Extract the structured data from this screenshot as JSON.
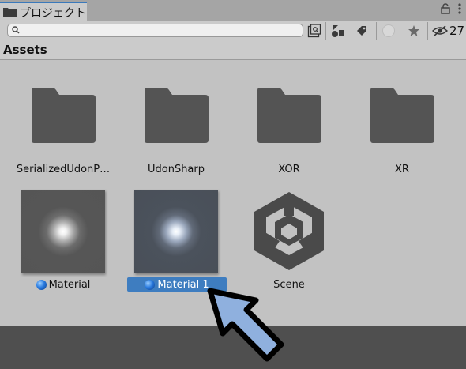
{
  "tab": {
    "title": "プロジェクト",
    "lock_icon": "lock-icon",
    "menu_icon": "kebab-menu-icon"
  },
  "toolbar": {
    "search_placeholder": "",
    "hidden_count": "27",
    "icons": [
      "search-icon",
      "create-menu-icon",
      "filter-by-type-icon",
      "filter-by-label-icon",
      "filter-by-status-icon",
      "favorite-icon",
      "hidden-packages-icon"
    ]
  },
  "breadcrumb": {
    "title": "Assets"
  },
  "colors": {
    "tab_accent": "#3a79bb",
    "selection": "#3e7dc0",
    "folder": "#545454",
    "bottom_panel": "#4f4f4f"
  },
  "assets": [
    {
      "name": "SerializedUdonP…",
      "type": "folder"
    },
    {
      "name": "UdonSharp",
      "type": "folder"
    },
    {
      "name": "XOR",
      "type": "folder"
    },
    {
      "name": "XR",
      "type": "folder"
    },
    {
      "name": "Material",
      "type": "material"
    },
    {
      "name": "Material 1",
      "type": "material",
      "selected": true
    },
    {
      "name": "Scene",
      "type": "scene"
    }
  ]
}
